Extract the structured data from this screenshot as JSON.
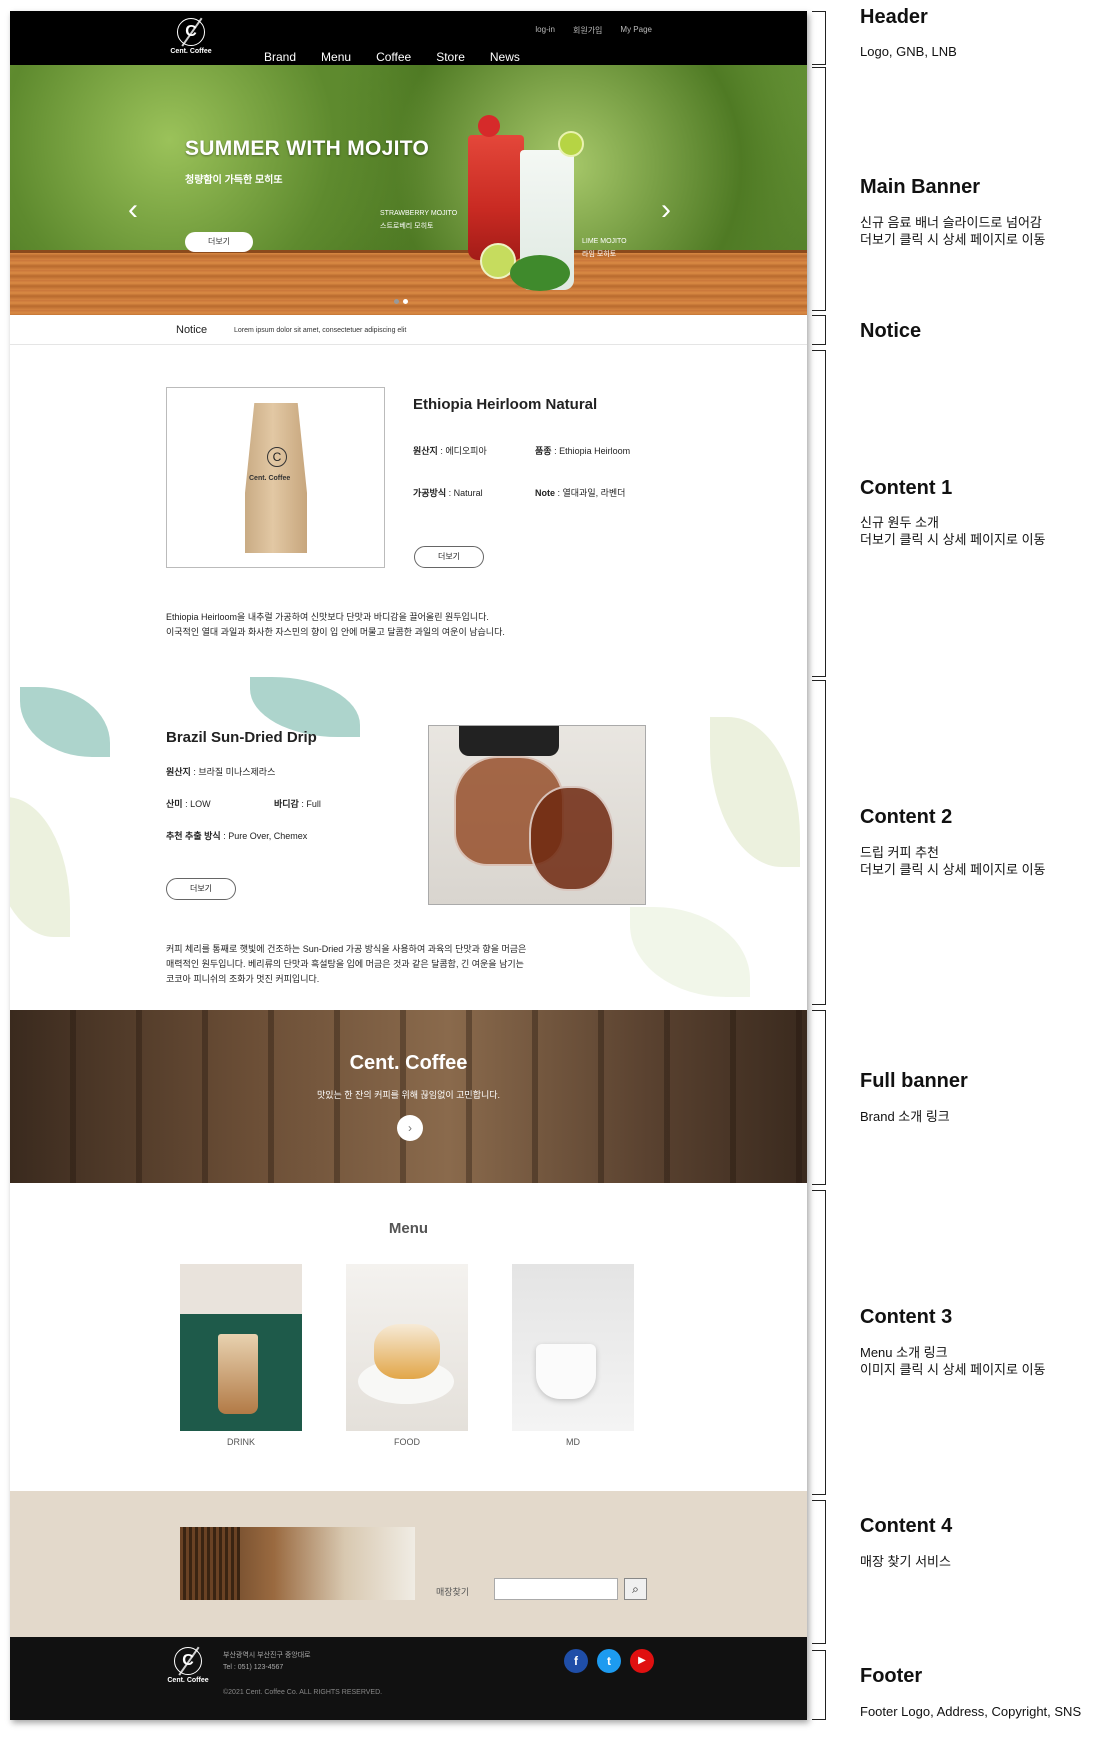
{
  "header": {
    "logo_text": "Cent. Coffee",
    "logo_letter": "C",
    "util": [
      "log-in",
      "회원가입",
      "My Page"
    ],
    "gnb": [
      "Brand",
      "Menu",
      "Coffee",
      "Store",
      "News"
    ]
  },
  "banner": {
    "title": "SUMMER WITH MOJITO",
    "subtitle": "청량함이 가득한 모히또",
    "button": "더보기",
    "label1_en": "STRAWBERRY MOJITO",
    "label1_ko": "스트로베리 모히토",
    "label2_en": "LIME MOJITO",
    "label2_ko": "라임 모히토",
    "prev": "‹",
    "next": "›"
  },
  "notice": {
    "title": "Notice",
    "text": "Lorem ipsum dolor sit amet,  consectetuer adipiscing elit"
  },
  "content1": {
    "bag_letter": "C",
    "bag_text": "Cent. Coffee",
    "title": "Ethiopia Heirloom Natural",
    "origin_label": "원산지",
    "origin_value": " : 에디오피아",
    "variety_label": "품종",
    "variety_value": " : Ethiopia Heirloom",
    "process_label": "가공방식",
    "process_value": " : Natural",
    "note_label": "Note",
    "note_value": " : 열대과일, 라벤더",
    "button": "더보기",
    "desc1": "Ethiopia Heirloom을 내추럴 가공하여 신맛보다 단맛과 바디감을 끌어올린 원두입니다.",
    "desc2": "이국적인 열대 과일과 화사한 자스민의 향이 입 안에 머물고 달콤한 과일의 여운이 남습니다."
  },
  "content2": {
    "title": "Brazil Sun-Dried Drip",
    "origin_label": "원산지",
    "origin_value": " : 브라질 미나스제라스",
    "acid_label": "산미",
    "acid_value": " : LOW",
    "body_label": "바디감",
    "body_value": " : Full",
    "brew_label": "추천 추출 방식",
    "brew_value": " : Pure Over, Chemex",
    "button": "더보기",
    "desc1": "커피 체리를 통째로 햇빛에 건조하는 Sun-Dried 가공 방식을 사용하여 과육의 단맛과 향을 머금은",
    "desc2": "매력적인 원두입니다. 베리류의 단맛과 흑설탕을 입에 머금은 것과 같은 달콤함, 긴 여운을 남기는",
    "desc3": "코코아 피니쉬의 조화가 멋진 커피입니다."
  },
  "full_banner": {
    "title": "Cent. Coffee",
    "subtitle": "맛있는 한 잔의 커피를 위해 끊임없이 고민합니다.",
    "button": "›"
  },
  "content3": {
    "title": "Menu",
    "items": [
      "DRINK",
      "FOOD",
      "MD"
    ]
  },
  "content4": {
    "label": "매장찾기",
    "input_value": "",
    "search_icon": "⌕"
  },
  "footer": {
    "logo_letter": "C",
    "logo_text": "Cent. Coffee",
    "address": "부산광역시 부산진구 중앙대로",
    "tel": "Tel : 051) 123-4567",
    "copyright": "©2021 Cent. Coffee Co. ALL RIGHTS RESERVED.",
    "sns": [
      {
        "icon": "facebook-icon",
        "glyph": "f",
        "color": "#1f4ea8"
      },
      {
        "icon": "twitter-icon",
        "glyph": "t",
        "color": "#1d9bf0"
      },
      {
        "icon": "youtube-icon",
        "glyph": "▶",
        "color": "#e01010"
      }
    ]
  },
  "annotations": [
    {
      "title": "Header",
      "desc": "Logo, GNB, LNB"
    },
    {
      "title": "Main Banner",
      "desc": "신규 음료 배너 슬라이드로 넘어감\n더보기 클릭 시 상세 페이지로 이동"
    },
    {
      "title": "Notice",
      "desc": ""
    },
    {
      "title": "Content 1",
      "desc": "신규 원두 소개\n더보기 클릭 시 상세 페이지로 이동"
    },
    {
      "title": "Content 2",
      "desc": "드립 커피 추천\n더보기 클릭 시 상세 페이지로 이동"
    },
    {
      "title": "Full banner",
      "desc": "Brand 소개 링크"
    },
    {
      "title": "Content 3",
      "desc": "Menu 소개 링크\n이미지 클릭 시 상세 페이지로 이동"
    },
    {
      "title": "Content 4",
      "desc": "매장 찾기 서비스"
    },
    {
      "title": "Footer",
      "desc": "Footer Logo,  Address, Copyright, SNS"
    }
  ]
}
